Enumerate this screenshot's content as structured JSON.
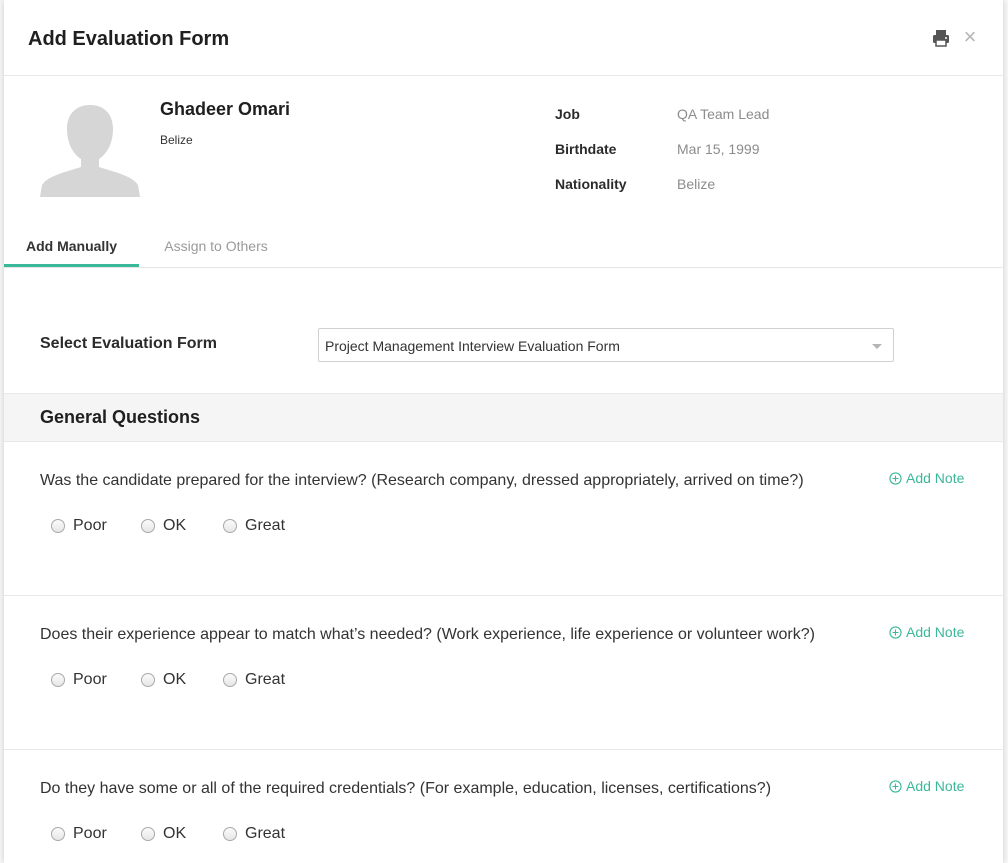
{
  "modal": {
    "title": "Add Evaluation Form",
    "print_icon": "print-icon",
    "close_icon": "close-icon",
    "close_glyph": "×"
  },
  "candidate": {
    "name": "Ghadeer Omari",
    "country": "Belize",
    "details": [
      {
        "label": "Job",
        "value": "QA Team Lead"
      },
      {
        "label": "Birthdate",
        "value": "Mar 15, 1999"
      },
      {
        "label": "Nationality",
        "value": "Belize"
      }
    ]
  },
  "tabs": [
    {
      "label": "Add Manually",
      "active": true
    },
    {
      "label": "Assign to Others",
      "active": false
    }
  ],
  "form_select": {
    "label": "Select Evaluation Form",
    "value": "Project Management Interview Evaluation Form"
  },
  "section": {
    "title": "General Questions"
  },
  "add_note_label": "Add Note",
  "rating_options": [
    "Poor",
    "OK",
    "Great"
  ],
  "questions": [
    {
      "text": "Was the candidate prepared for the interview? (Research company, dressed appropriately, arrived on time?)"
    },
    {
      "text": "Does their experience appear to match what’s needed? (Work experience, life experience or volunteer work?)"
    },
    {
      "text": "Do they have some or all of the required credentials? (For example, education, licenses, certifications?)"
    }
  ],
  "colors": {
    "accent": "#3bb89a",
    "label_text": "#2b2b2b",
    "muted_text": "#8c8c8c"
  }
}
